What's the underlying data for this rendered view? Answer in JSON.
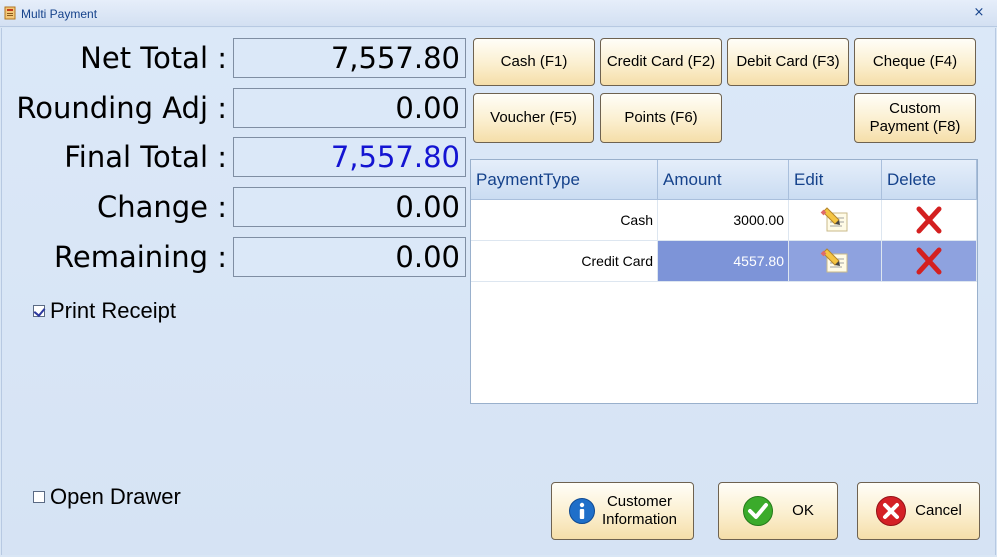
{
  "window": {
    "title": "Multi Payment",
    "close_glyph": "×"
  },
  "summary": {
    "net_total": {
      "label": "Net Total :",
      "value": "7,557.80"
    },
    "rounding_adj": {
      "label": "Rounding Adj :",
      "value": "0.00"
    },
    "final_total": {
      "label": "Final Total :",
      "value": "7,557.80"
    },
    "change": {
      "label": "Change :",
      "value": "0.00"
    },
    "remaining": {
      "label": "Remaining :",
      "value": "0.00"
    }
  },
  "options": {
    "print_receipt": {
      "label": "Print Receipt",
      "checked": true
    },
    "open_drawer": {
      "label": "Open Drawer",
      "checked": false
    }
  },
  "payment_buttons": {
    "cash": "Cash (F1)",
    "credit_card": "Credit Card (F2)",
    "debit_card": "Debit Card (F3)",
    "cheque": "Cheque (F4)",
    "voucher": "Voucher (F5)",
    "points": "Points (F6)",
    "custom_line1": "Custom",
    "custom_line2": "Payment (F8)"
  },
  "grid": {
    "columns": [
      "PaymentType",
      "Amount",
      "Edit",
      "Delete"
    ],
    "rows": [
      {
        "type": "Cash",
        "amount": "3000.00",
        "selected": false
      },
      {
        "type": "Credit Card",
        "amount": "4557.80",
        "selected": true
      }
    ]
  },
  "footer": {
    "customer_line1": "Customer",
    "customer_line2": "Information",
    "ok": "OK",
    "cancel": "Cancel"
  },
  "colors": {
    "final_total_text": "#1414d2",
    "selected_row": "#7d94d8",
    "delete_icon": "#d42020",
    "ok_icon": "#3bab2b",
    "cancel_icon": "#d42026",
    "info_icon": "#1f6fc9"
  }
}
